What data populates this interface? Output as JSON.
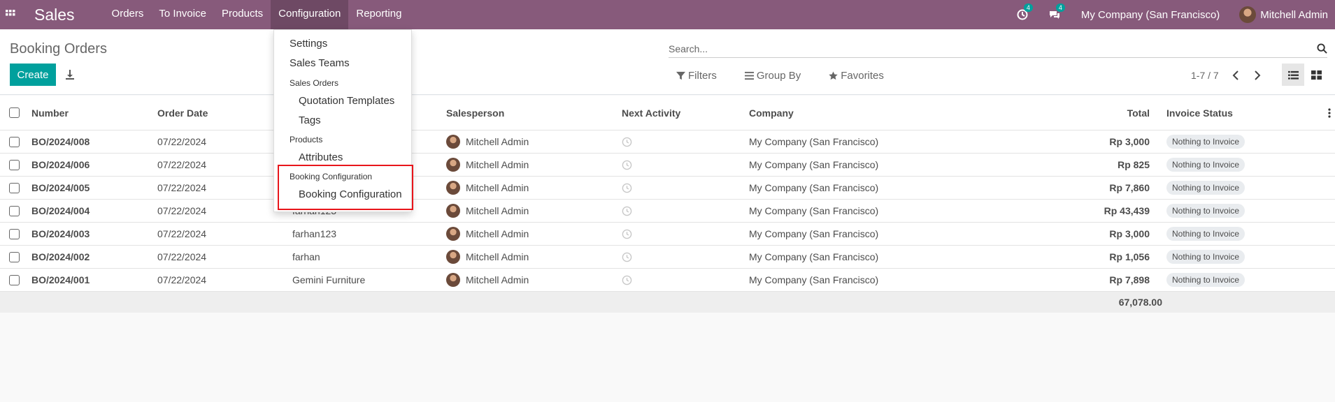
{
  "navbar": {
    "app_title": "Sales",
    "menu": [
      "Orders",
      "To Invoice",
      "Products",
      "Configuration",
      "Reporting"
    ],
    "activity_count": "4",
    "messages_count": "4",
    "company": "My Company (San Francisco)",
    "user": "Mitchell Admin",
    "color": "#875a7b"
  },
  "control_panel": {
    "title": "Booking Orders",
    "create_label": "Create",
    "search_placeholder": "Search...",
    "filters_label": "Filters",
    "groupby_label": "Group By",
    "favorites_label": "Favorites",
    "pager": "1-7 / 7"
  },
  "configuration_menu": {
    "settings": "Settings",
    "sales_teams": "Sales Teams",
    "sales_orders_header": "Sales Orders",
    "quotation_templates": "Quotation Templates",
    "tags": "Tags",
    "products_header": "Products",
    "attributes": "Attributes",
    "booking_header": "Booking Configuration",
    "booking_item": "Booking Configuration"
  },
  "table": {
    "columns": {
      "number": "Number",
      "order_date": "Order Date",
      "salesperson": "Salesperson",
      "next_activity": "Next Activity",
      "company": "Company",
      "total": "Total",
      "invoice_status": "Invoice Status"
    },
    "rows": [
      {
        "number": "BO/2024/008",
        "date": "07/22/2024",
        "customer": "",
        "salesperson": "Mitchell Admin",
        "company": "My Company (San Francisco)",
        "total": "Rp 3,000",
        "status": "Nothing to Invoice"
      },
      {
        "number": "BO/2024/006",
        "date": "07/22/2024",
        "customer": "",
        "salesperson": "Mitchell Admin",
        "company": "My Company (San Francisco)",
        "total": "Rp 825",
        "status": "Nothing to Invoice"
      },
      {
        "number": "BO/2024/005",
        "date": "07/22/2024",
        "customer": "",
        "salesperson": "Mitchell Admin",
        "company": "My Company (San Francisco)",
        "total": "Rp 7,860",
        "status": "Nothing to Invoice"
      },
      {
        "number": "BO/2024/004",
        "date": "07/22/2024",
        "customer": "farhan123",
        "salesperson": "Mitchell Admin",
        "company": "My Company (San Francisco)",
        "total": "Rp 43,439",
        "status": "Nothing to Invoice"
      },
      {
        "number": "BO/2024/003",
        "date": "07/22/2024",
        "customer": "farhan123",
        "salesperson": "Mitchell Admin",
        "company": "My Company (San Francisco)",
        "total": "Rp 3,000",
        "status": "Nothing to Invoice"
      },
      {
        "number": "BO/2024/002",
        "date": "07/22/2024",
        "customer": "farhan",
        "salesperson": "Mitchell Admin",
        "company": "My Company (San Francisco)",
        "total": "Rp 1,056",
        "status": "Nothing to Invoice"
      },
      {
        "number": "BO/2024/001",
        "date": "07/22/2024",
        "customer": "Gemini Furniture",
        "salesperson": "Mitchell Admin",
        "company": "My Company (San Francisco)",
        "total": "Rp 7,898",
        "status": "Nothing to Invoice"
      }
    ],
    "grand_total": "67,078.00"
  }
}
